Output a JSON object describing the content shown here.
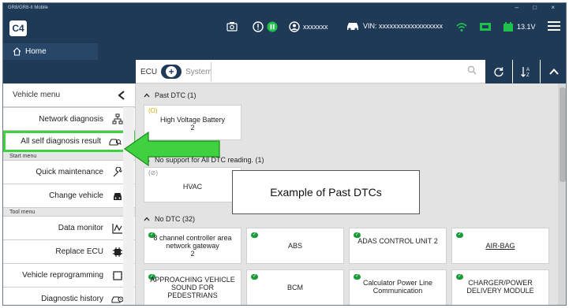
{
  "window": {
    "title": "GR8/GR8-II Mobile",
    "controls": [
      "–",
      "□",
      "×"
    ]
  },
  "header": {
    "logo": "C4",
    "user": "xxxxxxx",
    "vin": "VIN: xxxxxxxxxxxxxxxxxx",
    "voltage": "13.1V"
  },
  "home_tab": {
    "label": "Home"
  },
  "toolbar": {
    "ecu_label": "ECU",
    "system_label": "System",
    "search_placeholder": ""
  },
  "sidebar": {
    "title": "Vehicle menu",
    "items_top": [
      {
        "label": "Network diagnosis",
        "icon": "network-icon"
      },
      {
        "label": "All self diagnosis result",
        "icon": "car-search-icon",
        "highlighted": true
      }
    ],
    "section_start": "Start menu",
    "items_start": [
      {
        "label": "Quick maintenance",
        "icon": "wrench-icon"
      },
      {
        "label": "Change vehicle",
        "icon": "car-icon"
      }
    ],
    "section_tool": "Tool menu",
    "items_tool": [
      {
        "label": "Data monitor",
        "icon": "graph-icon"
      },
      {
        "label": "Replace ECU",
        "icon": "chip-icon"
      },
      {
        "label": "Vehicle reprogramming",
        "icon": "reprogram-icon"
      },
      {
        "label": "Diagnostic history",
        "icon": "history-icon"
      }
    ]
  },
  "groups": {
    "past": {
      "label": "Past DTC (1)"
    },
    "nosupport": {
      "label": "No support for All DTC reading. (1)"
    },
    "nodtc": {
      "label": "No DTC (32)"
    }
  },
  "cards": {
    "past_1": {
      "status": "(O)",
      "name": "High Voltage Battery",
      "count": "2"
    },
    "nosupport_1": {
      "status": "(⊘)",
      "name": "HVAC"
    },
    "nodtc": [
      {
        "name": "8 channel controller area network gateway",
        "count": "2"
      },
      {
        "name": "ABS"
      },
      {
        "name": "ADAS CONTROL UNIT 2"
      },
      {
        "name": "AIR-BAG"
      },
      {
        "name": "APPROACHING VEHICLE SOUND FOR PEDESTRIANS"
      },
      {
        "name": "BCM"
      },
      {
        "name": "Calculator Power Line Communication"
      },
      {
        "name": "CHARGER/POWER DELIVERY MODULE"
      }
    ]
  },
  "callout": {
    "text": "Example of Past DTCs"
  },
  "colors": {
    "header": "#1f3a57",
    "highlight": "#3fd13f",
    "ok_green": "#1a9b3a",
    "past_yellow": "#d8a800"
  }
}
